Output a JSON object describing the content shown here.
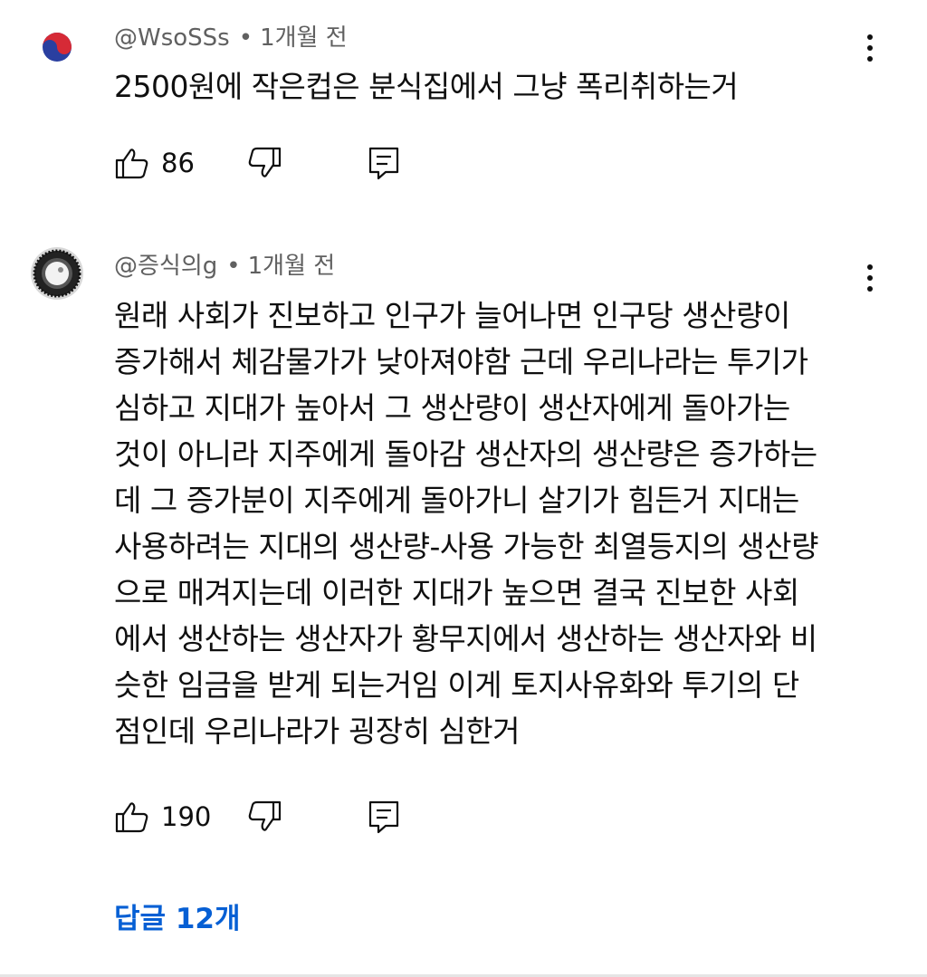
{
  "comments": [
    {
      "handle": "@WsoSSs",
      "separator": "•",
      "time": "1개월 전",
      "lines": [
        "2500원에 작은컵은 분식집에서 그냥 폭리취하는거"
      ],
      "likes": "86",
      "avatar_icon": "taegeuk-icon"
    },
    {
      "handle": "@증식의g",
      "separator": "•",
      "time": "1개월 전",
      "lines": [
        "원래 사회가 진보하고 인구가 늘어나면 인구당 생산량이",
        "증가해서 체감물가가 낮아져야함 근데 우리나라는 투기가",
        "심하고 지대가 높아서 그 생산량이 생산자에게 돌아가는",
        "것이 아니라 지주에게 돌아감 생산자의 생산량은 증가하는",
        "데 그 증가분이 지주에게 돌아가니 살기가 힘든거 지대는",
        "사용하려는 지대의 생산량-사용 가능한 최열등지의 생산량",
        "으로 매겨지는데 이러한 지대가 높으면 결국 진보한 사회",
        "에서 생산하는 생산자가 황무지에서 생산하는 생산자와 비",
        "슷한 임금을 받게 되는거임 이게 토지사유화와 투기의 단",
        "점인데 우리나라가 굉장히 심한거"
      ],
      "likes": "190",
      "avatar_icon": "gear-icon"
    }
  ],
  "replies_label": "답글 12개",
  "colors": {
    "accent": "#065fd4",
    "text": "#0f0f0f",
    "meta": "#606060"
  }
}
